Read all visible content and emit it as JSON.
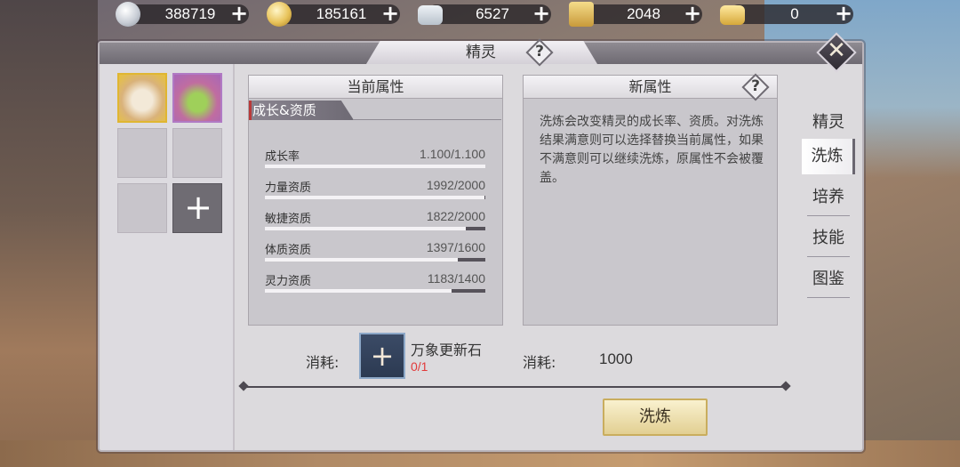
{
  "currencies": [
    {
      "name": "silver-coin",
      "value": "388719"
    },
    {
      "name": "gold-coin",
      "value": "185161"
    },
    {
      "name": "silver-ingot",
      "value": "6527"
    },
    {
      "name": "gold-treasure",
      "value": "2048"
    },
    {
      "name": "gold-ingot",
      "value": "0"
    }
  ],
  "currency_plus": "+",
  "window": {
    "title": "精灵",
    "help": "?",
    "close": "✕"
  },
  "current_attrs": {
    "header": "当前属性",
    "section": "成长&资质",
    "stats": [
      {
        "label": "成长率",
        "value": "1.100/1.100",
        "fraction": 1.0
      },
      {
        "label": "力量资质",
        "value": "1992/2000",
        "fraction": 0.996
      },
      {
        "label": "敏捷资质",
        "value": "1822/2000",
        "fraction": 0.911
      },
      {
        "label": "体质资质",
        "value": "1397/1600",
        "fraction": 0.873
      },
      {
        "label": "灵力资质",
        "value": "1183/1400",
        "fraction": 0.845
      }
    ]
  },
  "new_attrs": {
    "header": "新属性",
    "help": "?",
    "description": "洗炼会改变精灵的成长率、资质。对洗炼结果满意则可以选择替换当前属性，如果不满意则可以继续洗炼，原属性不会被覆盖。"
  },
  "tabs": [
    "精灵",
    "洗炼",
    "培养",
    "技能",
    "图鉴"
  ],
  "active_tab": "洗炼",
  "cost": {
    "label1": "消耗:",
    "item_name": "万象更新石",
    "item_count": "0/1",
    "item_glyph": "+",
    "label2": "消耗:",
    "amount": "1000"
  },
  "add_slot_glyph": "+",
  "refine_button": "洗炼"
}
